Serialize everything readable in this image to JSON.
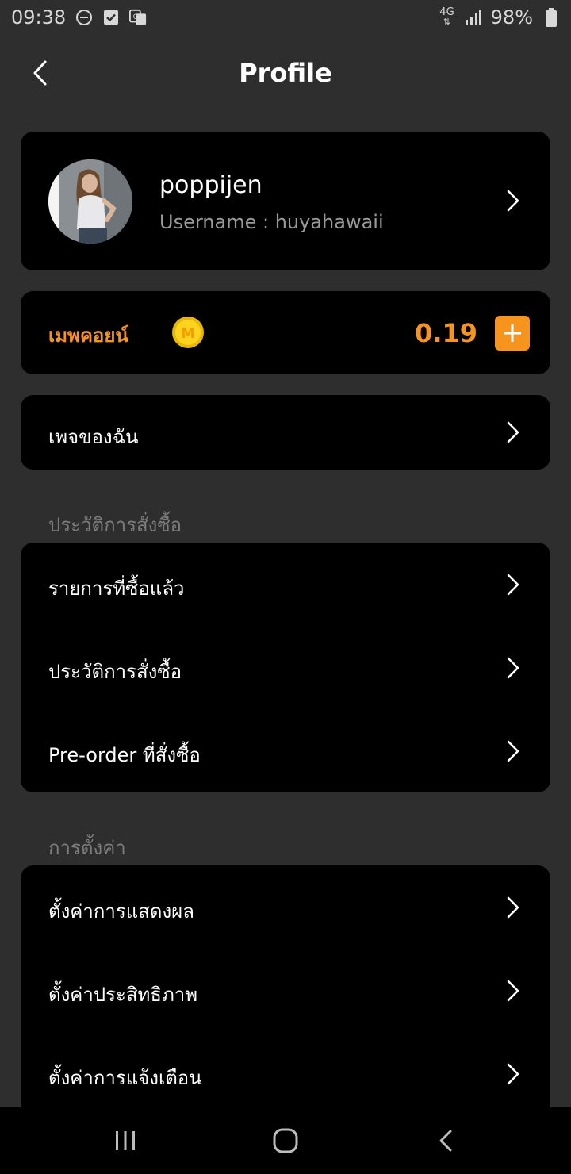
{
  "status_bar": {
    "time": "09:38",
    "network": "4G",
    "battery": "98%"
  },
  "header": {
    "title": "Profile"
  },
  "profile": {
    "display_name": "poppijen",
    "username_line": "Username : huyahawaii"
  },
  "coins": {
    "label": "เมพคอยน์",
    "icon_letter": "M",
    "balance": "0.19"
  },
  "my_page": {
    "label": "เพจของฉัน"
  },
  "purchase_section": {
    "title": "ประวัติการสั่งซื้อ",
    "items": [
      {
        "label": "รายการที่ซื้อแล้ว"
      },
      {
        "label": "ประวัติการสั่งซื้อ"
      },
      {
        "label": "Pre-order ที่สั่งซื้อ"
      }
    ]
  },
  "settings_section": {
    "title": "การตั้งค่า",
    "items": [
      {
        "label": "ตั้งค่าการแสดงผล"
      },
      {
        "label": "ตั้งค่าประสิทธิภาพ"
      },
      {
        "label": "ตั้งค่าการแจ้งเตือน"
      }
    ]
  },
  "colors": {
    "accent": "#f7941d",
    "background": "#2e2e2e",
    "card": "#000000"
  }
}
